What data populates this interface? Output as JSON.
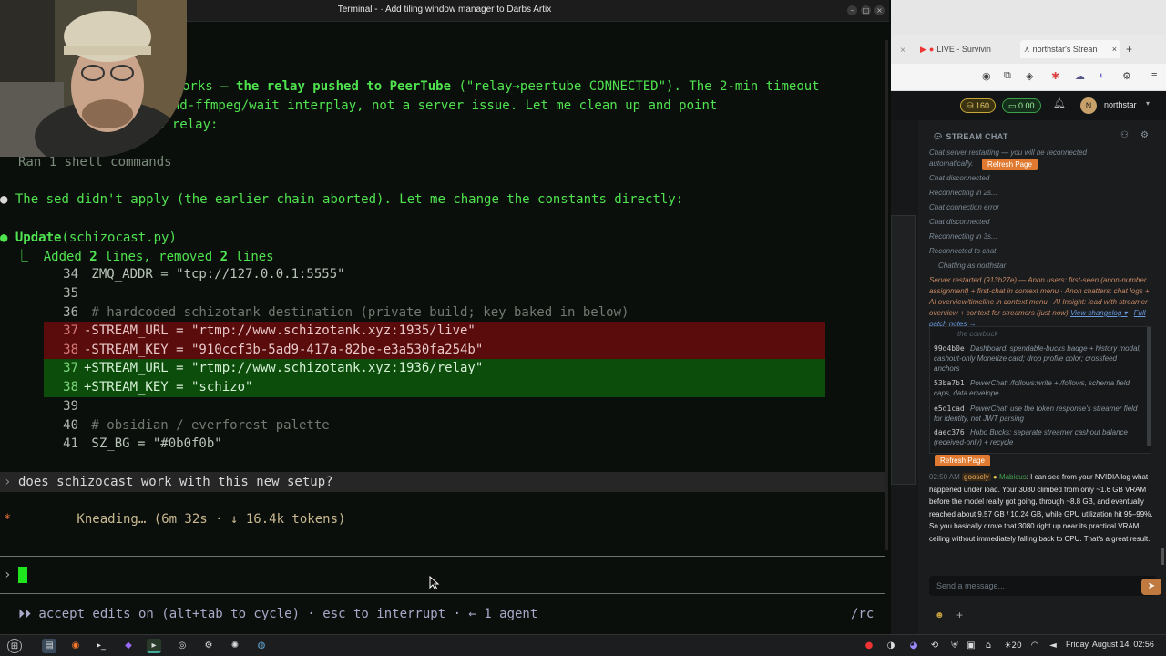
{
  "terminal": {
    "title": "Terminal - · Add tiling window manager to Darbs Artix",
    "lines": {
      "l1_prefix": "orks — ",
      "l1_bold": "the relay pushed to PeerTube",
      "l1_rest": " (\"relay→peertube CONNECTED\"). The 2-min timeout",
      "l2": "ound-ffmpeg/wait interplay, not a server issue. Let me clean up and point",
      "l3": "e relay:",
      "ran": "Ran 1 shell commands",
      "sed_bullet": "●",
      "sed": " The sed didn't apply (the earlier chain aborted). Let me change the constants directly:",
      "update_bullet": "●",
      "update_label": " Update",
      "update_file": "(schizocast.py)",
      "added_prefix": "  ⎿  Added ",
      "added_n": "2",
      "added_mid": " lines, removed ",
      "removed_n": "2",
      "added_suffix": " lines"
    },
    "diff": [
      {
        "ln": "34",
        "text": " ZMQ_ADDR = \"tcp://127.0.0.1:5555\"",
        "kind": "ctx"
      },
      {
        "ln": "35",
        "text": "",
        "kind": "ctx"
      },
      {
        "ln": "36",
        "text": " # hardcoded schizotank destination (private build; key baked in below)",
        "kind": "comment"
      },
      {
        "ln": "37",
        "text": "-STREAM_URL = \"rtmp://www.schizotank.xyz:1935/live\"",
        "kind": "del"
      },
      {
        "ln": "38",
        "text": "-STREAM_KEY = \"910ccf3b-5ad9-417a-82be-e3a530fa254b\"",
        "kind": "del"
      },
      {
        "ln": "37",
        "text": "+STREAM_URL = \"rtmp://www.schizotank.xyz:1936/relay\"",
        "kind": "add"
      },
      {
        "ln": "38",
        "text": "+STREAM_KEY = \"schizo\"",
        "kind": "add"
      },
      {
        "ln": "39",
        "text": "",
        "kind": "ctx"
      },
      {
        "ln": "40",
        "text": " # obsidian / everforest palette",
        "kind": "comment"
      },
      {
        "ln": "41",
        "text": " SZ_BG = \"#0b0f0b\"",
        "kind": "ctx"
      }
    ],
    "user_prompt_marker": "›",
    "user_message": "does schizocast work with this new setup?",
    "status_star": "*",
    "status": " Kneading… (6m 32s · ↓ 16.4k tokens)",
    "input_marker": "›",
    "footer": "⏵⏵ accept edits on (alt+tab to cycle) · esc to interrupt · ← 1 agent",
    "footer_right": "/rc"
  },
  "browser": {
    "tab1": "LIVE - Survivin",
    "tab2": "northstar's Strean",
    "tab_new": "+",
    "coins": "160",
    "bucks": "0.00",
    "user_initial": "N",
    "username": "northstar",
    "chat_header": "STREAM CHAT",
    "chat": {
      "restart_notice": "Chat server restarting — you will be reconnected automatically.",
      "refresh_label": "Refresh Page",
      "s1": "Chat disconnected",
      "s2": "Reconnecting in 2s...",
      "s3": "Chat connection error",
      "s4": "Chat disconnected",
      "s5": "Reconnecting in 3s...",
      "s6": "Reconnected to chat",
      "s7": "Chatting as northstar",
      "restarted": "Server restarted (913b27e) — Anon users: first-seen (anon-number assignment) + first-chat in context menu · Anon chatters: chat logs + AI overview/timeline in context menu · AI Insight: lead with streamer overview + context for streamers (just now)",
      "view_changelog": "View changelog ▾",
      "full_patch": "Full patch notes →",
      "cutoff": "the cowbuck",
      "commits": [
        {
          "hash": "99d4b0e",
          "text": "Dashboard: spendable-bucks badge + history modal; cashout-only Monetize card; drop profile color; crossfeed anchors"
        },
        {
          "hash": "53ba7b1",
          "text": "PowerChat: /follows:write + /follows, schema field caps, data envelope"
        },
        {
          "hash": "e5d1cad",
          "text": "PowerChat: use the token response's streamer field for identity, not JWT parsing"
        },
        {
          "hash": "daec376",
          "text": "Hobo Bucks: separate streamer cashout balance (received-only) + recycle"
        }
      ],
      "refresh2": "Refresh Page",
      "msg_time": "02:50 AM",
      "msg_badge": "goosely",
      "msg_user": "Mabicus",
      "msg_text": ": I can see from your NVIDIA log what happened under load. Your 3080 climbed from only ~1.6 GB VRAM before the model really got going, through ~8.8 GB, and eventually reached about 9.57 GB / 10.24 GB, while GPU utilization hit 95–99%. So you basically drove that 3080 right up near its practical VRAM ceiling without immediately falling back to CPU. That's a great result.",
      "placeholder": "Send a message..."
    }
  },
  "taskbar": {
    "clock": "Friday, August 14, 02:56",
    "temp": "20"
  },
  "colors": {
    "terminal_bg": "#0b0f0b",
    "accent_green": "#4fe34f",
    "diff_del": "#5a0b0b",
    "diff_add": "#0c4d0c",
    "chat_bg": "#1a1c1e",
    "orange": "#e07a30"
  }
}
